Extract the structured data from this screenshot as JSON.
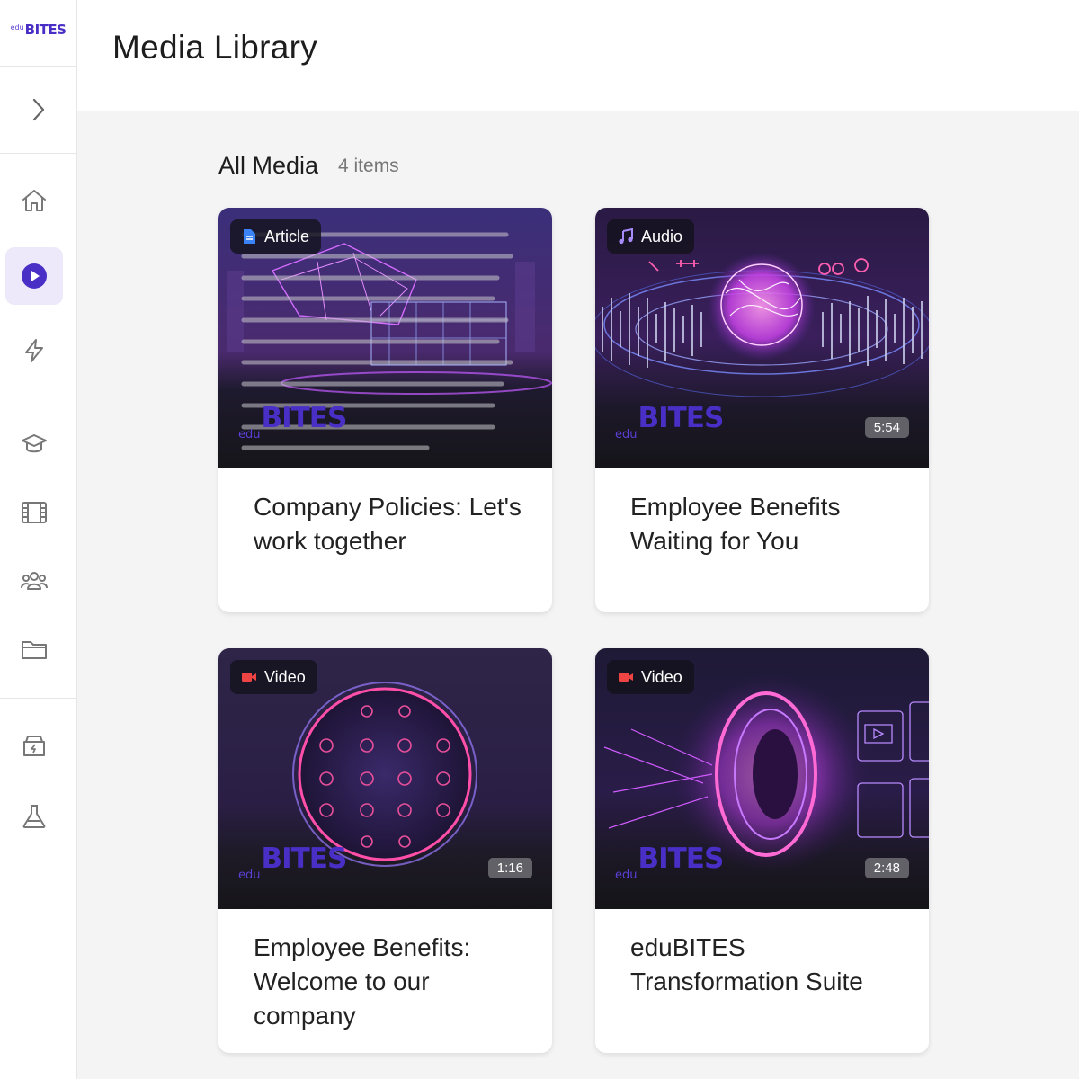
{
  "app": {
    "logo_prefix": "edu",
    "logo_text": "BITES"
  },
  "sidebar": {
    "expand_icon": "chevron-right-icon",
    "items": [
      {
        "name": "home",
        "icon": "home-icon",
        "active": false
      },
      {
        "name": "media",
        "icon": "play-circle-icon",
        "active": true
      },
      {
        "name": "quick",
        "icon": "lightning-icon",
        "active": false
      },
      {
        "name": "courses",
        "icon": "graduation-cap-icon",
        "active": false
      },
      {
        "name": "videos",
        "icon": "film-icon",
        "active": false
      },
      {
        "name": "groups",
        "icon": "users-icon",
        "active": false
      },
      {
        "name": "files",
        "icon": "folder-icon",
        "active": false
      },
      {
        "name": "storage",
        "icon": "archive-bolt-icon",
        "active": false
      },
      {
        "name": "lab",
        "icon": "flask-icon",
        "active": false
      }
    ]
  },
  "header": {
    "title": "Media Library"
  },
  "main": {
    "section_title": "All Media",
    "section_count": "4 items",
    "cards": [
      {
        "type": "Article",
        "title": "Company Policies: Let's work together",
        "duration": "",
        "brand_prefix": "edu",
        "brand": "BITES"
      },
      {
        "type": "Audio",
        "title": "Employee Benefits Waiting for You",
        "duration": "5:54",
        "brand_prefix": "edu",
        "brand": "BITES"
      },
      {
        "type": "Video",
        "title": "Employee Benefits: Welcome to our company",
        "duration": "1:16",
        "brand_prefix": "edu",
        "brand": "BITES"
      },
      {
        "type": "Video",
        "title": "eduBITES Transformation Suite",
        "duration": "2:48",
        "brand_prefix": "edu",
        "brand": "BITES"
      }
    ]
  },
  "colors": {
    "accent": "#4a2fc6",
    "active_bg": "#ede9fb",
    "main_bg": "#f4f4f5",
    "article_icon": "#3b82f6",
    "audio_icon": "#a78bfa",
    "video_icon": "#ef4444"
  }
}
